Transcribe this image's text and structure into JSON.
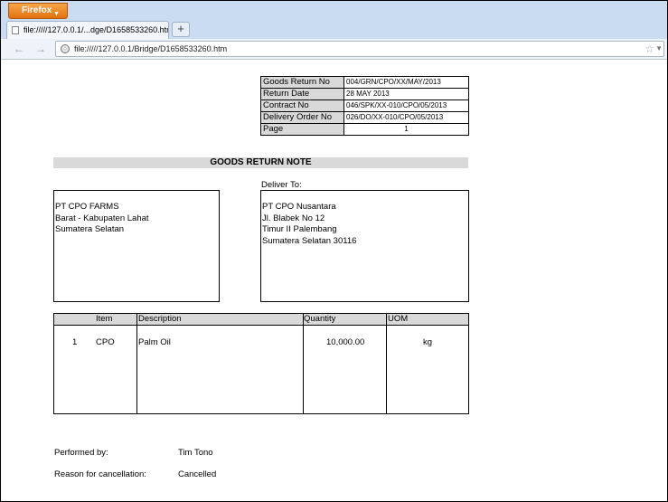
{
  "browser": {
    "app_button_label": "Firefox",
    "tab_title": "file://///127.0.0.1/...dge/D1658533260.htm",
    "new_tab_label": "+",
    "url": "file://///127.0.0.1/Bridge/D1658533260.htm"
  },
  "document": {
    "info_rows": [
      {
        "label": "Goods Return No",
        "value": "004/GRN/CPO/XX/MAY/2013"
      },
      {
        "label": "Return Date",
        "value": "28 MAY 2013"
      },
      {
        "label": "Contract No",
        "value": "046/SPK/XX-010/CPO/05/2013"
      },
      {
        "label": "Delivery Order No",
        "value": "026/DO/XX-010/CPO/05/2013"
      },
      {
        "label": "Page",
        "value": "1"
      }
    ],
    "title": "GOODS RETURN NOTE",
    "deliver_to_label": "Deliver To:",
    "from_address": [
      "PT CPO FARMS",
      "Barat - Kabupaten Lahat",
      "Sumatera Selatan"
    ],
    "to_address": [
      "PT CPO Nusantara",
      "Jl. Blabek No 12",
      "Timur II Palembang",
      "Sumatera Selatan 30116"
    ],
    "items_table": {
      "headers": {
        "item": "Item",
        "description": "Description",
        "quantity": "Quantity",
        "uom": "UOM"
      },
      "rows": [
        {
          "no": "1",
          "item": "CPO",
          "description": "Palm Oil",
          "quantity": "10,000.00",
          "uom": "kg"
        }
      ]
    },
    "performed_by_label": "Performed by:",
    "performed_by_value": "Tim Tono",
    "reason_label": "Reason for cancellation:",
    "reason_value": "Cancelled"
  }
}
